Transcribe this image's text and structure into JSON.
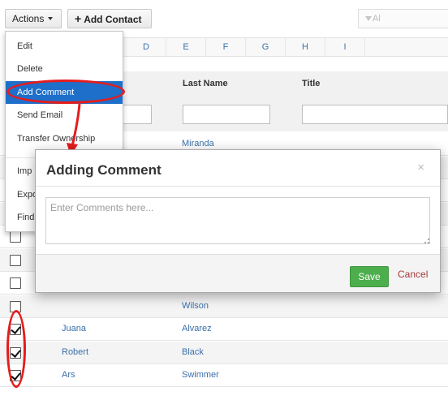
{
  "toolbar": {
    "actions_label": "Actions",
    "add_contact_label": "Add Contact",
    "filter_hint": "Al"
  },
  "column_letters": [
    "D",
    "E",
    "F",
    "G",
    "H",
    "I"
  ],
  "table": {
    "headers": {
      "last_name": "Last Name",
      "title": "Title"
    },
    "rows": [
      {
        "first": "",
        "last": "Miranda",
        "checked": false
      },
      {
        "first": "",
        "last": "",
        "checked": false
      },
      {
        "first": "",
        "last": "",
        "checked": false
      },
      {
        "first": "",
        "last": "",
        "checked": false
      },
      {
        "first": "",
        "last": "",
        "checked": false
      },
      {
        "first": "",
        "last": "",
        "checked": false
      },
      {
        "first": "",
        "last": "",
        "checked": false
      },
      {
        "first": "",
        "last": "Wilson",
        "checked": false
      },
      {
        "first": "Juana",
        "last": "Alvarez",
        "checked": true
      },
      {
        "first": "Robert",
        "last": "Black",
        "checked": true
      },
      {
        "first": "Ars",
        "last": "Swimmer",
        "checked": true
      }
    ]
  },
  "actions_menu": {
    "items": [
      {
        "label": "Edit"
      },
      {
        "label": "Delete"
      },
      {
        "label": "Add Comment",
        "active": true
      },
      {
        "label": "Send Email"
      },
      {
        "label": "Transfer Ownership"
      },
      {
        "label": "Imp"
      },
      {
        "label": "Expo"
      },
      {
        "label": "Find"
      }
    ]
  },
  "modal": {
    "title": "Adding Comment",
    "close_icon": "×",
    "textarea_placeholder": "Enter Comments here...",
    "save_label": "Save",
    "cancel_label": "Cancel"
  },
  "colors": {
    "menu_active": "#1e6fc9",
    "annotation_red": "#e51c1c",
    "save_green": "#4cae4c",
    "link_blue": "#3a6fa8"
  }
}
